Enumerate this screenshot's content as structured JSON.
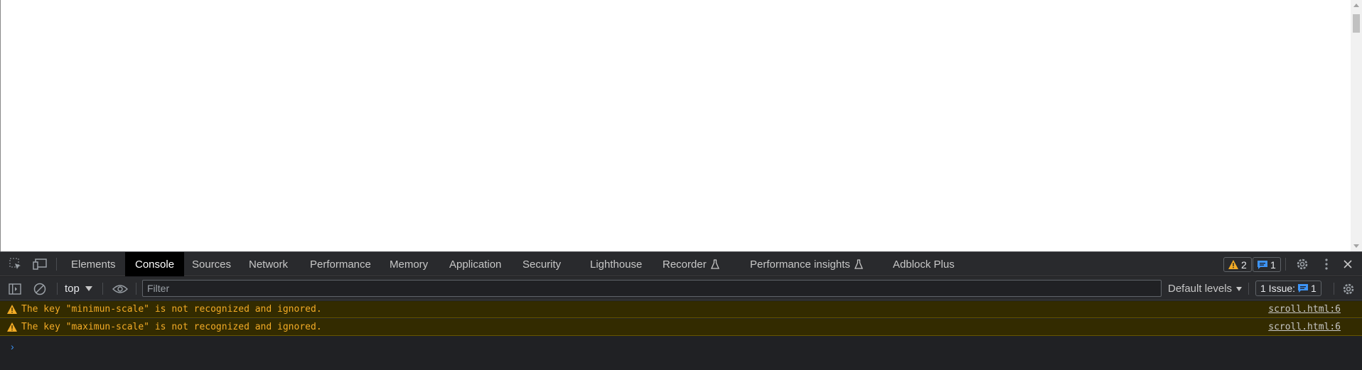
{
  "devtools": {
    "tabs": [
      {
        "label": "Elements",
        "active": false,
        "experimental": false
      },
      {
        "label": "Console",
        "active": true,
        "experimental": false
      },
      {
        "label": "Sources",
        "active": false,
        "experimental": false
      },
      {
        "label": "Network",
        "active": false,
        "experimental": false
      },
      {
        "label": "Performance",
        "active": false,
        "experimental": false
      },
      {
        "label": "Memory",
        "active": false,
        "experimental": false
      },
      {
        "label": "Application",
        "active": false,
        "experimental": false
      },
      {
        "label": "Security",
        "active": false,
        "experimental": false
      },
      {
        "label": "Lighthouse",
        "active": false,
        "experimental": false
      },
      {
        "label": "Recorder",
        "active": false,
        "experimental": true
      },
      {
        "label": "Performance insights",
        "active": false,
        "experimental": true
      },
      {
        "label": "Adblock Plus",
        "active": false,
        "experimental": false
      }
    ],
    "warnings_count": "2",
    "messages_count": "1"
  },
  "console_toolbar": {
    "context": "top",
    "filter_placeholder": "Filter",
    "levels": "Default levels",
    "issues_label": "1 Issue:",
    "issues_count": "1"
  },
  "messages": [
    {
      "level": "warning",
      "text": "The key \"minimun-scale\" is not recognized and ignored.",
      "source": "scroll.html:6"
    },
    {
      "level": "warning",
      "text": "The key \"maximun-scale\" is not recognized and ignored.",
      "source": "scroll.html:6"
    }
  ],
  "prompt_symbol": "›",
  "colors": {
    "accent": "#3d94f6",
    "warning_text": "#f2ab26",
    "warning_bg": "#332b00",
    "panel_bg": "#202124"
  }
}
